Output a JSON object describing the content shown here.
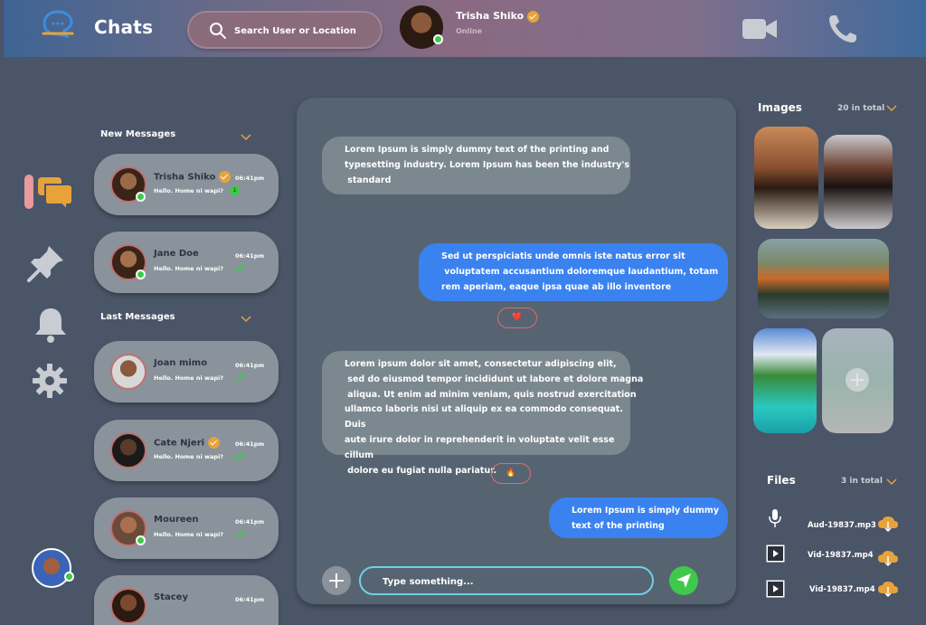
{
  "header": {
    "app_title": "Chats",
    "search_placeholder": "Search User or Location",
    "active_contact": {
      "name": "Trisha Shiko",
      "status": "Online"
    }
  },
  "chat_list": {
    "new_messages_label": "New Messages",
    "last_messages_label": "Last Messages",
    "new": [
      {
        "name": "Trisha Shiko",
        "preview": "Hello. Home ni wapi?",
        "time": "06:41pm",
        "status": "unread",
        "unread_count": "1",
        "verified": true
      },
      {
        "name": "Jane Doe",
        "preview": "Hello. Home ni wapi?",
        "time": "06:41pm",
        "status": "read",
        "verified": false
      }
    ],
    "last": [
      {
        "name": "Joan mimo",
        "preview": "Hello. Home ni wapi?",
        "time": "06:41pm",
        "status": "read",
        "verified": false
      },
      {
        "name": "Cate Njeri",
        "preview": "Hello. Home ni wapi?",
        "time": "06:41pm",
        "status": "read",
        "verified": true
      },
      {
        "name": "Moureen",
        "preview": "Hello. Home ni wapi?",
        "time": "06:41pm",
        "status": "read",
        "verified": false
      },
      {
        "name": "Stacey",
        "preview": "",
        "time": "06:41pm",
        "status": "read",
        "verified": false
      }
    ]
  },
  "conversation": {
    "messages": [
      {
        "direction": "in",
        "lines": [
          "Lorem Ipsum is simply dummy text of the printing and",
          "typesetting industry. Lorem Ipsum has been the industry's",
          " standard"
        ]
      },
      {
        "direction": "out",
        "lines": [
          "Sed ut perspiciatis unde omnis iste natus error sit",
          " voluptatem accusantium doloremque laudantium, totam",
          "rem aperiam, eaque ipsa quae ab illo inventore"
        ],
        "reaction": "❤️"
      },
      {
        "direction": "in",
        "lines": [
          "Lorem ipsum dolor sit amet, consectetur adipiscing elit,",
          " sed do eiusmod tempor incididunt ut labore et dolore magna",
          " aliqua. Ut enim ad minim veniam, quis nostrud exercitation",
          "ullamco laboris nisi ut aliquip ex ea commodo consequat. Duis",
          "aute irure dolor in reprehenderit in voluptate velit esse cillum",
          " dolore eu fugiat nulla pariatur."
        ],
        "reaction": "🔥"
      },
      {
        "direction": "out",
        "lines": [
          "Lorem Ipsum is simply dummy",
          "text of the printing"
        ]
      }
    ],
    "compose_placeholder": "Type something..."
  },
  "sidebar_right": {
    "images_title": "Images",
    "images_count": "20 in total",
    "files_title": "Files",
    "files_count": "3 in total",
    "files": [
      {
        "name": "Aud-19837.mp3",
        "icon": "microphone-icon"
      },
      {
        "name": "Vid-19837.mp4",
        "icon": "video-file-icon"
      },
      {
        "name": "Vid-19837.mp4",
        "icon": "video-file-icon"
      }
    ]
  },
  "colors": {
    "background": "#4a5568",
    "panel": "#566472",
    "incoming_bubble": "#7c8890",
    "outgoing_bubble": "#3a82f0",
    "accent_orange": "#e7a33a",
    "online_green": "#3ec94a",
    "send_green": "#3ec94a"
  }
}
